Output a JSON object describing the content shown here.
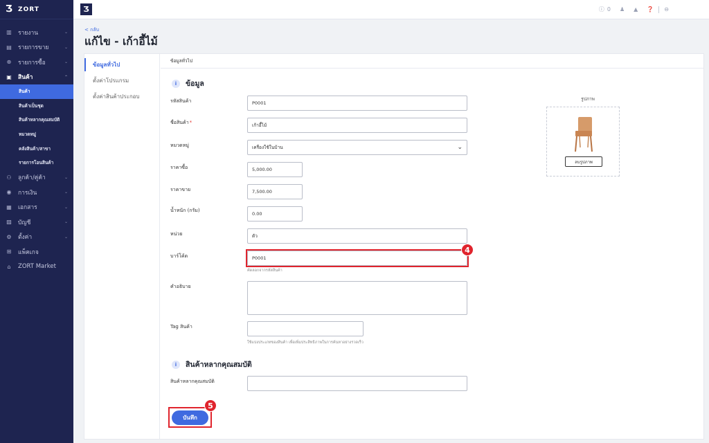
{
  "brand": {
    "logo": "Ʒ",
    "name": "ZORT"
  },
  "sidebar": {
    "items": [
      {
        "label": "รายงาน",
        "icon": "chart-icon",
        "glyph": "▥"
      },
      {
        "label": "รายการขาย",
        "icon": "receipt-icon",
        "glyph": "▤"
      },
      {
        "label": "รายการซื้อ",
        "icon": "cart-icon",
        "glyph": "⊕"
      },
      {
        "label": "สินค้า",
        "icon": "box-icon",
        "glyph": "▣"
      },
      {
        "label": "ลูกค้า/คู่ค้า",
        "icon": "users-icon",
        "glyph": "⚇"
      },
      {
        "label": "การเงิน",
        "icon": "money-icon",
        "glyph": "◉"
      },
      {
        "label": "เอกสาร",
        "icon": "document-icon",
        "glyph": "▦"
      },
      {
        "label": "บัญชี",
        "icon": "ledger-icon",
        "glyph": "▨"
      },
      {
        "label": "ตั้งค่า",
        "icon": "gear-icon",
        "glyph": "⚙"
      },
      {
        "label": "แพ็คเกจ",
        "icon": "package-icon",
        "glyph": "⊞"
      },
      {
        "label": "ZORT Market",
        "icon": "store-icon",
        "glyph": "⌂"
      }
    ],
    "sub_items": [
      {
        "label": "สินค้า"
      },
      {
        "label": "สินค้าเป็นชุด"
      },
      {
        "label": "สินค้าหลากคุณสมบัติ"
      },
      {
        "label": "หมวดหมู่"
      },
      {
        "label": "คลังสินค้า/สาขา"
      },
      {
        "label": "รายการโอนสินค้า"
      }
    ]
  },
  "topbar": {
    "logo": "Ʒ",
    "notification_count": "0"
  },
  "page": {
    "back_label": "< กลับ",
    "title": "แก้ไข - เก้าอี้ไม้"
  },
  "tabs": [
    {
      "label": "ข้อมูลทั่วไป"
    },
    {
      "label": "ตั้งค่าโปรแกรม"
    },
    {
      "label": "ตั้งค่าสินค้าประกอบ"
    }
  ],
  "section": {
    "header": "ข้อมูลทั่วไป",
    "heading": "ข้อมูล",
    "variant_heading": "สินค้าหลากคุณสมบัติ"
  },
  "form": {
    "sku_label": "รหัสสินค้า",
    "sku_value": "P0001",
    "name_label": "ชื่อสินค้า",
    "name_required": "*",
    "name_value": "เก้าอี้ไม้",
    "category_label": "หมวดหมู่",
    "category_value": "เครื่องใช้ในบ้าน",
    "buy_price_label": "ราคาซื้อ",
    "buy_price_value": "5,000.00",
    "sell_price_label": "ราคาขาย",
    "sell_price_value": "7,500.00",
    "weight_label": "น้ำหนัก (กรัม)",
    "weight_value": "0.00",
    "unit_label": "หน่วย",
    "unit_value": "ตัว",
    "barcode_label": "บาร์โค้ด",
    "barcode_value": "P0001",
    "barcode_hint": "คัดลอกจากรหัสสินค้า",
    "description_label": "คำอธิบาย",
    "description_value": "",
    "tag_label": "Tag สินค้า",
    "tag_value": "",
    "tag_hint": "ใช้แบ่งประเภทของสินค้า เพื่อเพิ่มประสิทธิภาพในการค้นหาอย่างรวดเร็ว",
    "variant_label": "สินค้าหลากคุณสมบัติ",
    "variant_value": ""
  },
  "image": {
    "title": "รูปภาพ",
    "delete_label": "ลบรูปภาพ"
  },
  "annotations": {
    "barcode_step": "4",
    "save_step": "5",
    "highlight_color": "#e0242d"
  },
  "save_label": "บันทึก"
}
